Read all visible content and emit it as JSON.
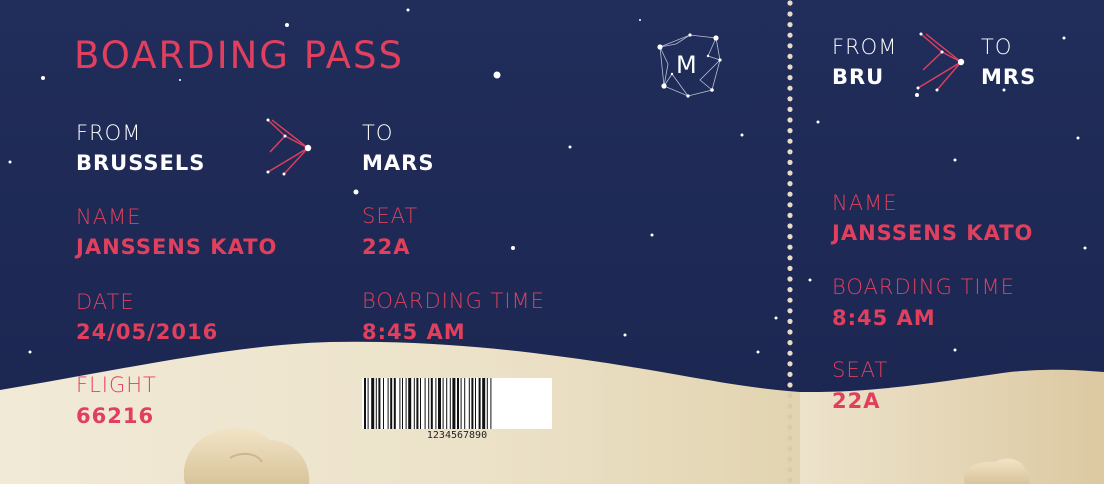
{
  "title": "BOARDING PASS",
  "logo_letter": "M",
  "main": {
    "from_label": "FROM",
    "from_value": "BRUSSELS",
    "to_label": "TO",
    "to_value": "MARS",
    "name_label": "NAME",
    "name_value": "JANSSENS KATO",
    "seat_label": "SEAT",
    "seat_value": "22A",
    "date_label": "DATE",
    "date_value": "24/05/2016",
    "boarding_label": "BOARDING TIME",
    "boarding_value": "8:45 AM",
    "flight_label": "FLIGHT",
    "flight_value": "66216",
    "barcode_number": "1234567890"
  },
  "stub": {
    "from_label": "FROM",
    "from_value": "BRU",
    "to_label": "TO",
    "to_value": "MRS",
    "name_label": "NAME",
    "name_value": "JANSSENS KATO",
    "boarding_label": "BOARDING TIME",
    "boarding_value": "8:45 AM",
    "seat_label": "SEAT",
    "seat_value": "22A"
  },
  "colors": {
    "background": "#1f2a55",
    "accent": "#e0405e",
    "sand": "#ede3cc",
    "text_light": "#ffffff"
  },
  "icons": [
    "constellation-logo-icon",
    "arrow-chevrons-icon"
  ]
}
